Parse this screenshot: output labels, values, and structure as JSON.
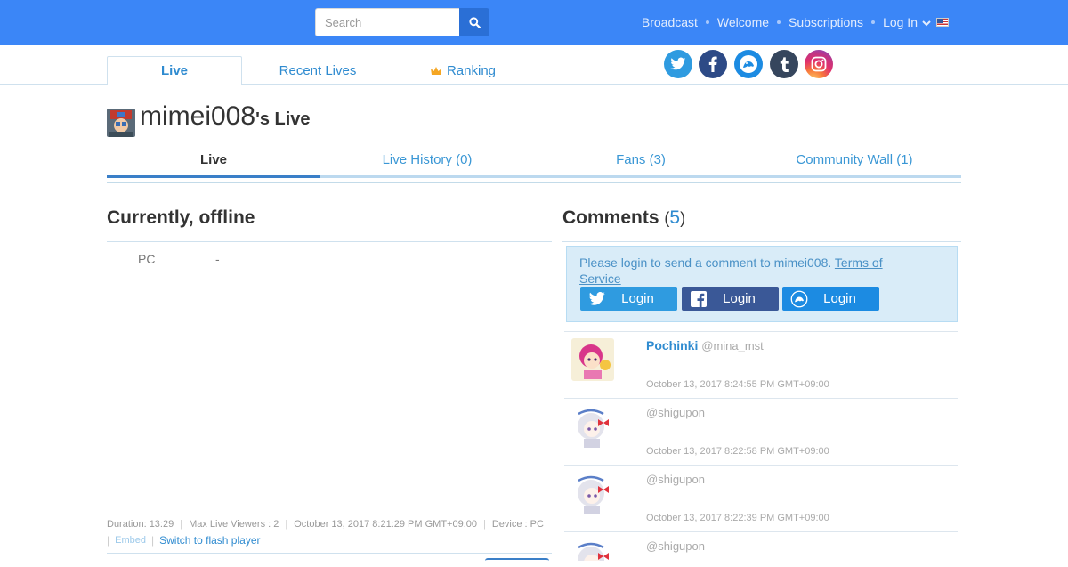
{
  "header": {
    "search_placeholder": "Search",
    "nav": [
      "Broadcast",
      "Welcome",
      "Subscriptions",
      "Log In"
    ],
    "brand_color": "#3b86f7"
  },
  "subnav": {
    "tabs": [
      "Live",
      "Recent Lives",
      "Ranking"
    ],
    "active": "Live",
    "social": [
      "twitter-icon",
      "facebook-icon",
      "twitcasting-icon",
      "tumblr-icon",
      "instagram-icon"
    ]
  },
  "profile": {
    "username": "mimei008",
    "title_suffix": "'s Live",
    "tabs": [
      "Live",
      "Live History (0)",
      "Fans (3)",
      "Community Wall (1)"
    ]
  },
  "live": {
    "status": "Currently, offline",
    "device_label": "PC",
    "device_value": "-",
    "duration": "Duration: 13:29",
    "max_viewers": "Max Live Viewers : 2",
    "date": "October 13, 2017 8:21:29 PM GMT+09:00",
    "device": "Device : PC",
    "embed": "Embed",
    "switch_player": "Switch to flash player"
  },
  "comments": {
    "heading": "Comments",
    "count": "5",
    "login_message": "Please login to send a comment to mimei008.",
    "terms": "Terms of Service",
    "login_buttons": [
      "Login",
      "Login",
      "Login"
    ],
    "items": [
      {
        "name": "Pochinki",
        "handle": "@mina_mst",
        "time": "October 13, 2017 8:24:55 PM GMT+09:00"
      },
      {
        "name": "",
        "handle": "@shigupon",
        "time": "October 13, 2017 8:22:58 PM GMT+09:00"
      },
      {
        "name": "",
        "handle": "@shigupon",
        "time": "October 13, 2017 8:22:39 PM GMT+09:00"
      },
      {
        "name": "",
        "handle": "@shigupon",
        "time": ""
      }
    ]
  }
}
